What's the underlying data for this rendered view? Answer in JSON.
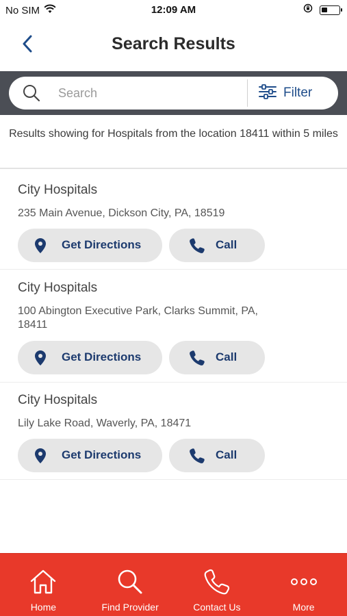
{
  "status_bar": {
    "carrier": "No SIM",
    "time": "12:09 AM",
    "battery_level": 0.35
  },
  "header": {
    "title": "Search Results",
    "back_icon": "chevron-left-icon"
  },
  "search": {
    "placeholder": "Search",
    "value": "",
    "filter_label": "Filter"
  },
  "results_info": "Results showing for Hospitals from the location 18411 within 5 miles",
  "results": [
    {
      "name": "City Hospitals",
      "address": "235 Main Avenue, Dickson City, PA, 18519",
      "directions_label": "Get Directions",
      "call_label": "Call"
    },
    {
      "name": "City Hospitals",
      "address": "100 Abington Executive Park, Clarks Summit, PA, 18411",
      "directions_label": "Get Directions",
      "call_label": "Call"
    },
    {
      "name": "City Hospitals",
      "address": "Lily Lake Road, Waverly, PA, 18471",
      "directions_label": "Get Directions",
      "call_label": "Call"
    }
  ],
  "tab_bar": {
    "items": [
      {
        "label": "Home",
        "icon": "home-icon"
      },
      {
        "label": "Find Provider",
        "icon": "search-icon"
      },
      {
        "label": "Contact Us",
        "icon": "phone-icon"
      },
      {
        "label": "More",
        "icon": "more-icon"
      }
    ]
  },
  "colors": {
    "brand_red": "#e8392a",
    "accent_blue": "#1e4c8a",
    "pill_bg": "#e6e6e6",
    "search_band": "#4b4e55"
  }
}
